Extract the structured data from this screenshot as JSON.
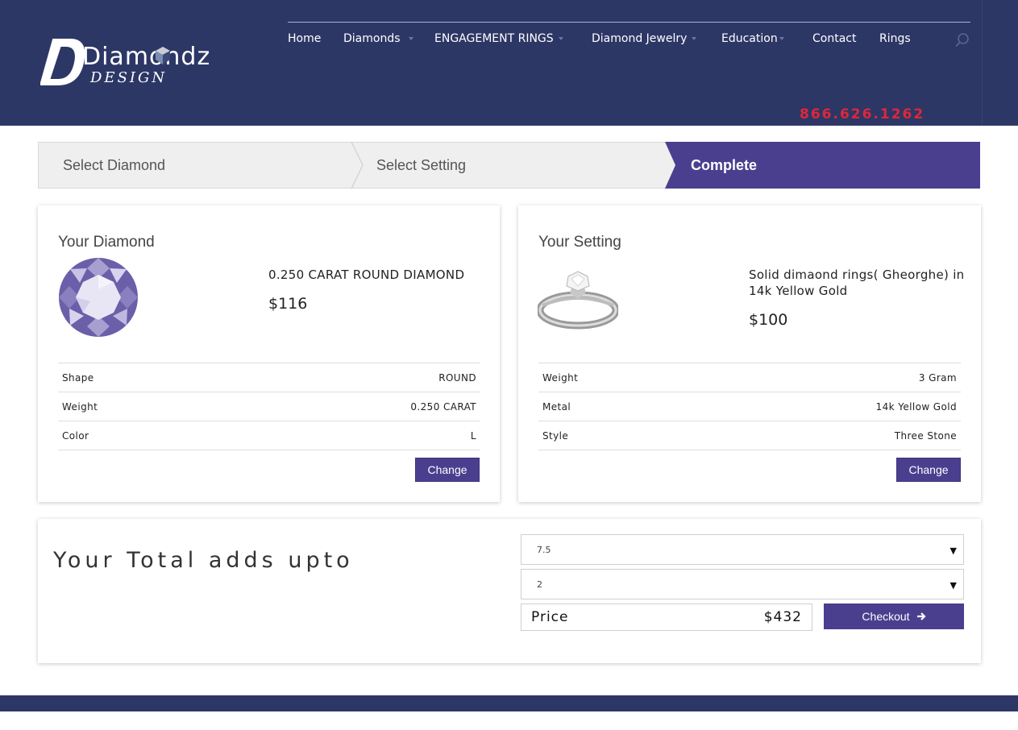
{
  "header": {
    "brand_line1": "Diamondz",
    "brand_line2": "DESIGN",
    "phone": "866.626.1262",
    "nav": [
      {
        "label": "Home"
      },
      {
        "label": "Diamonds"
      },
      {
        "label": "ENGAGEMENT RINGS"
      },
      {
        "label": "Diamond Jewelry"
      },
      {
        "label": "Education"
      },
      {
        "label": "Contact"
      },
      {
        "label": "Rings"
      }
    ],
    "search_icon": "search-icon"
  },
  "steps": {
    "step1": "Select Diamond",
    "step2": "Select Setting",
    "step3": "Complete"
  },
  "diamond": {
    "title": "Your Diamond",
    "name": "0.250 CARAT ROUND DIAMOND",
    "price": "$116",
    "specs": [
      {
        "label": "Shape",
        "value": "ROUND"
      },
      {
        "label": "Weight",
        "value": "0.250 CARAT"
      },
      {
        "label": "Color",
        "value": "L"
      }
    ],
    "change_label": "Change"
  },
  "setting": {
    "title": "Your Setting",
    "name": "Solid dimaond rings( Gheorghe) in 14k Yellow Gold",
    "price": "$100",
    "specs": [
      {
        "label": "Weight",
        "value": "3 Gram"
      },
      {
        "label": "Metal",
        "value": "14k Yellow Gold"
      },
      {
        "label": "Style",
        "value": "Three Stone"
      }
    ],
    "change_label": "Change"
  },
  "total": {
    "title": "Your Total adds upto",
    "ring_size": "7.5",
    "quantity": "2",
    "price_label": "Price",
    "price_value": "$432",
    "checkout_label": "Checkout"
  },
  "colors": {
    "header_bg": "#2d3766",
    "accent": "#4a3f8f",
    "phone": "#e0263a",
    "step_inactive": "#efefef"
  }
}
